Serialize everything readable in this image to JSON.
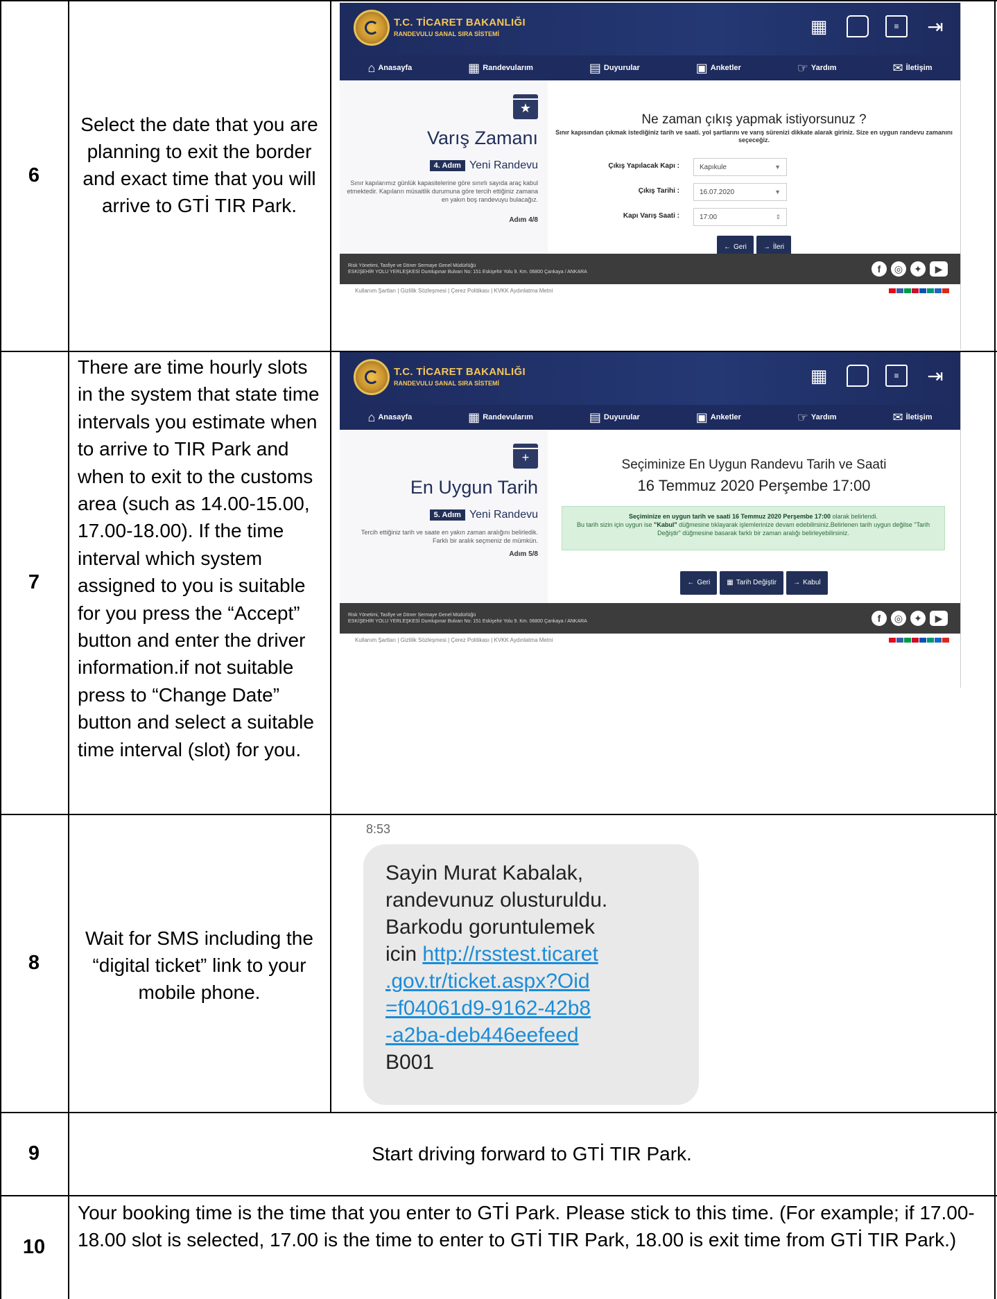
{
  "rows": [
    {
      "num": "6",
      "text": "Select the date that you are planning to exit the border and exact time that you will arrive to GTİ TIR Park."
    },
    {
      "num": "7",
      "text": "There are time hourly slots in the system that state time intervals you estimate when to arrive to TIR Park and when to exit to the customs area (such as 14.00-15.00, 17.00-18.00). If the time interval which system assigned to you is suitable for you press the “Accept” button and enter the driver information.if not suitable press to “Change Date” button and select a suitable time interval (slot) for you."
    },
    {
      "num": "8",
      "text": "Wait for SMS including the “digital ticket” link to your mobile phone."
    },
    {
      "num": "9",
      "text": "Start driving forward to GTİ TIR Park."
    },
    {
      "num": "10",
      "text": "Your booking time is the time that you enter to GTİ Park. Please stick to this time. (For example; if 17.00-18.00 slot is selected, 17.00 is the time to enter to GTİ TIR Park, 18.00 is exit time from GTİ TIR Park.)"
    }
  ],
  "app": {
    "title": "T.C. TİCARET BAKANLIĞI",
    "subtitle": "RANDEVULU SANAL SIRA SİSTEMİ",
    "menu": [
      "Anasayfa",
      "Randevularım",
      "Duyurular",
      "Anketler",
      "Yardım",
      "İletişim"
    ],
    "footer_line1": "Risk Yönetimi, Tasfiye ve Döner Sermaye Genel Müdürlüğü",
    "footer_line2": "ESKİŞEHİR YOLU YERLEŞKESİ Dumlupınar Bulvarı No: 151 Eskişehir Yolu 9. Km. 06800 Çankaya / ANKARA",
    "footer_links": "Kullanım Şartları   |   Gizlilik Sözleşmesi   |   Çerez Politikası   |   KVKK Aydınlatma Metni"
  },
  "shot1": {
    "card_title": "Varış Zamanı",
    "step_badge": "4. Adım",
    "step_label": "Yeni Randevu",
    "card_text": "Sınır kapılarımız günlük kapasitelerine göre sınırlı sayıda araç kabul etmektedir. Kapıların müsaitlik durumuna göre tercih ettiğiniz zamana en yakın boş randevuyu bulacağız.",
    "step_count": "Adım 4/8",
    "question": "Ne zaman çıkış yapmak istiyorsunuz ?",
    "question_sub": "Sınır kapısından çıkmak istediğiniz tarih ve saati. yol şartlarını ve varış sürenizi dikkate alarak giriniz. Size en uygun randevu zamanını seçeceğiz.",
    "field1_label": "Çıkış Yapılacak Kapı :",
    "field1_value": "Kapıkule",
    "field2_label": "Çıkış Tarihi :",
    "field2_value": "16.07.2020",
    "field3_label": "Kapı Varış Saati :",
    "field3_value": "17:00",
    "back": "Geri",
    "next": "İleri"
  },
  "shot2": {
    "card_title": "En Uygun Tarih",
    "step_badge": "5. Adım",
    "step_label": "Yeni Randevu",
    "card_text": "Tercih ettiğiniz tarih ve saate en yakın zaman aralığını belirledik. Farklı bir aralık seçmeniz de mümkün.",
    "step_count": "Adım 5/8",
    "result_title": "Seçiminize En Uygun Randevu Tarih ve Saati",
    "result_date": "16 Temmuz 2020 Perşembe 17:00",
    "green_bold": "Seçiminize en uygun tarih ve saati 16 Temmuz 2020 Perşembe 17:00",
    "green_rest1": " olarak belirlendi.",
    "green_line2a": "Bu tarih sizin için uygun ise ",
    "green_kabul": "\"Kabul\"",
    "green_line2b": " düğmesine tıklayarak işlemlerinize devam edebilirsiniz.Belirlenen tarih uygun değilse \"Tarih Değiştir\" düğmesine basarak farklı bir zaman aralığı belirleyebilirsiniz.",
    "back": "Geri",
    "change": "Tarih Değiştir",
    "accept": "Kabul"
  },
  "sms": {
    "time": "8:53",
    "line1": "Sayin Murat Kabalak,",
    "line2": "randevunuz olusturuldu.",
    "line3": "Barkodu goruntulemek",
    "line4_prefix": "icin ",
    "link_l1": "http://rsstest.ticaret",
    "link_l2": ".gov.tr/ticket.aspx?Oid",
    "link_l3": "=f04061d9-9162-42b8",
    "link_l4": "-a2ba-deb446eefeed",
    "code": "B001"
  }
}
